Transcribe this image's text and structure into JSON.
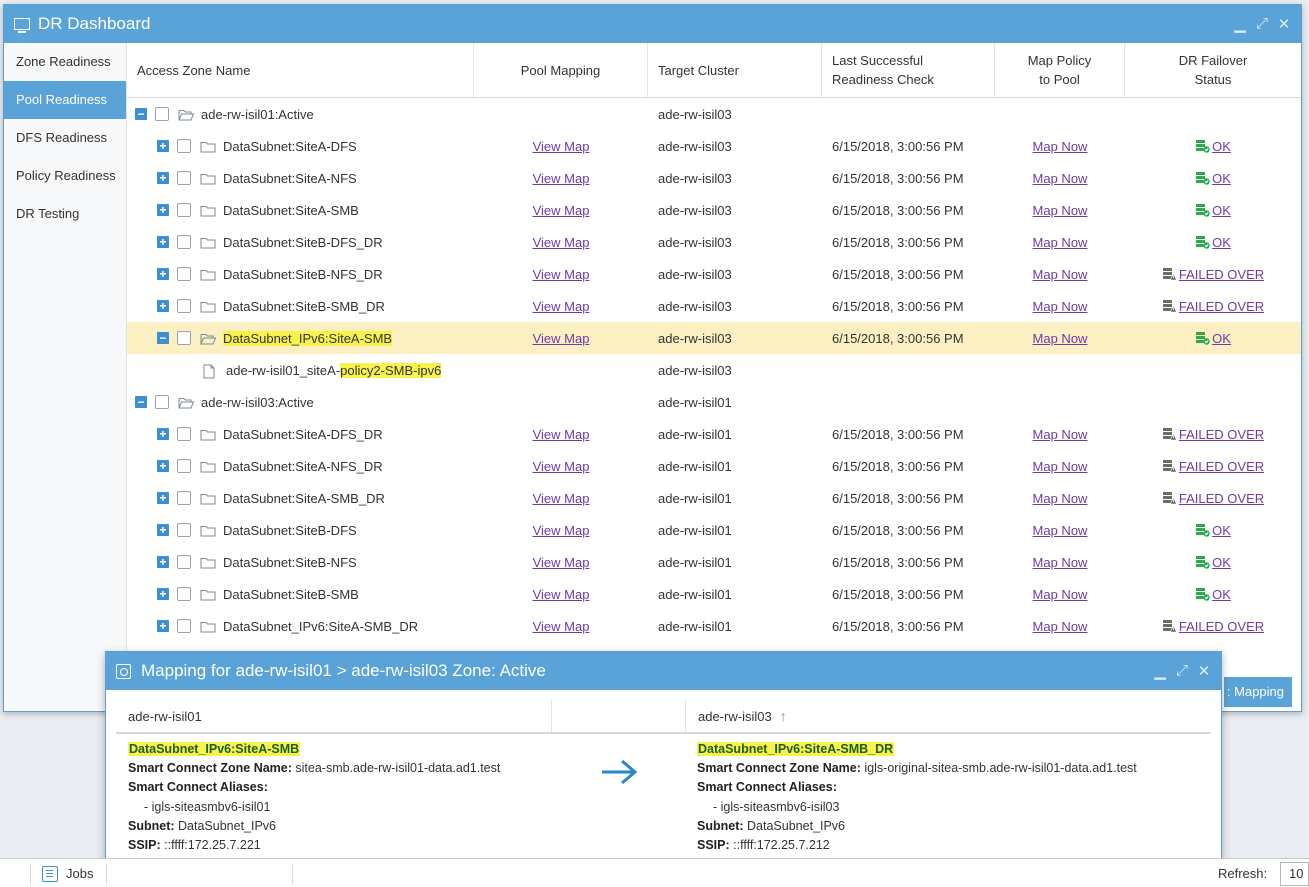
{
  "window": {
    "title": "DR Dashboard",
    "controls": {
      "minimize": "▁",
      "maximize": "⤢",
      "close": "✕"
    }
  },
  "sidebar": {
    "items": [
      {
        "label": "Zone Readiness",
        "active": false
      },
      {
        "label": "Pool Readiness",
        "active": true
      },
      {
        "label": "DFS Readiness",
        "active": false
      },
      {
        "label": "Policy Readiness",
        "active": false
      },
      {
        "label": "DR Testing",
        "active": false
      }
    ]
  },
  "grid": {
    "headers": {
      "access_zone": "Access Zone Name",
      "pool_mapping": "Pool Mapping",
      "target_cluster": "Target Cluster",
      "last_check_1": "Last Successful",
      "last_check_2": "Readiness Check",
      "map_policy_1": "Map Policy",
      "map_policy_2": "to Pool",
      "dr_status_1": "DR Failover",
      "dr_status_2": "Status"
    },
    "rows": [
      {
        "type": "zone",
        "name": "ade-rw-isil01:Active",
        "target": "ade-rw-isil03"
      },
      {
        "type": "pool",
        "name": "DataSubnet:SiteA-DFS",
        "map": "View Map",
        "target": "ade-rw-isil03",
        "check": "6/15/2018, 3:00:56 PM",
        "policy": "Map Now",
        "status": "OK"
      },
      {
        "type": "pool",
        "name": "DataSubnet:SiteA-NFS",
        "map": "View Map",
        "target": "ade-rw-isil03",
        "check": "6/15/2018, 3:00:56 PM",
        "policy": "Map Now",
        "status": "OK"
      },
      {
        "type": "pool",
        "name": "DataSubnet:SiteA-SMB",
        "map": "View Map",
        "target": "ade-rw-isil03",
        "check": "6/15/2018, 3:00:56 PM",
        "policy": "Map Now",
        "status": "OK"
      },
      {
        "type": "pool",
        "name": "DataSubnet:SiteB-DFS_DR",
        "map": "View Map",
        "target": "ade-rw-isil03",
        "check": "6/15/2018, 3:00:56 PM",
        "policy": "Map Now",
        "status": "OK"
      },
      {
        "type": "pool",
        "name": "DataSubnet:SiteB-NFS_DR",
        "map": "View Map",
        "target": "ade-rw-isil03",
        "check": "6/15/2018, 3:00:56 PM",
        "policy": "Map Now",
        "status": "FAILED OVER"
      },
      {
        "type": "pool",
        "name": "DataSubnet:SiteB-SMB_DR",
        "map": "View Map",
        "target": "ade-rw-isil03",
        "check": "6/15/2018, 3:00:56 PM",
        "policy": "Map Now",
        "status": "FAILED OVER"
      },
      {
        "type": "pool-open",
        "name": "DataSubnet_IPv6:SiteA-SMB",
        "map": "View Map",
        "target": "ade-rw-isil03",
        "check": "6/15/2018, 3:00:56 PM",
        "policy": "Map Now",
        "status": "OK",
        "selected": true,
        "highlight": true
      },
      {
        "type": "policy",
        "name_prefix": "ade-rw-isil01_siteA-",
        "name_highlight": "policy2-SMB-ipv6",
        "target": "ade-rw-isil03"
      },
      {
        "type": "zone",
        "name": "ade-rw-isil03:Active",
        "target": "ade-rw-isil01"
      },
      {
        "type": "pool",
        "name": "DataSubnet:SiteA-DFS_DR",
        "map": "View Map",
        "target": "ade-rw-isil01",
        "check": "6/15/2018, 3:00:56 PM",
        "policy": "Map Now",
        "status": "FAILED OVER"
      },
      {
        "type": "pool",
        "name": "DataSubnet:SiteA-NFS_DR",
        "map": "View Map",
        "target": "ade-rw-isil01",
        "check": "6/15/2018, 3:00:56 PM",
        "policy": "Map Now",
        "status": "FAILED OVER"
      },
      {
        "type": "pool",
        "name": "DataSubnet:SiteA-SMB_DR",
        "map": "View Map",
        "target": "ade-rw-isil01",
        "check": "6/15/2018, 3:00:56 PM",
        "policy": "Map Now",
        "status": "FAILED OVER"
      },
      {
        "type": "pool",
        "name": "DataSubnet:SiteB-DFS",
        "map": "View Map",
        "target": "ade-rw-isil01",
        "check": "6/15/2018, 3:00:56 PM",
        "policy": "Map Now",
        "status": "OK"
      },
      {
        "type": "pool",
        "name": "DataSubnet:SiteB-NFS",
        "map": "View Map",
        "target": "ade-rw-isil01",
        "check": "6/15/2018, 3:00:56 PM",
        "policy": "Map Now",
        "status": "OK"
      },
      {
        "type": "pool",
        "name": "DataSubnet:SiteB-SMB",
        "map": "View Map",
        "target": "ade-rw-isil01",
        "check": "6/15/2018, 3:00:56 PM",
        "policy": "Map Now",
        "status": "OK"
      },
      {
        "type": "pool",
        "name": "DataSubnet_IPv6:SiteA-SMB_DR",
        "map": "View Map",
        "target": "ade-rw-isil01",
        "check": "6/15/2018, 3:00:56 PM",
        "policy": "Map Now",
        "status": "FAILED OVER"
      }
    ]
  },
  "edge_button": ": Mapping",
  "mapping_popup": {
    "title": "Mapping for ade-rw-isil01 > ade-rw-isil03 Zone: Active",
    "left_header": "ade-rw-isil01",
    "right_header": "ade-rw-isil03",
    "sort_icon": "↑",
    "left": {
      "pool": "DataSubnet_IPv6:SiteA-SMB",
      "sc_zone_label": "Smart Connect Zone Name:",
      "sc_zone": "sitea-smb.ade-rw-isil01-data.ad1.test",
      "aliases_label": "Smart Connect Aliases:",
      "alias": "- igls-siteasmbv6-isil01",
      "subnet_label": "Subnet:",
      "subnet": "DataSubnet_IPv6",
      "ssip_label": "SSIP:",
      "ssip": "::ffff:172.25.7.221"
    },
    "right": {
      "pool": "DataSubnet_IPv6:SiteA-SMB_DR",
      "sc_zone_label": "Smart Connect Zone Name:",
      "sc_zone": "igls-original-sitea-smb.ade-rw-isil01-data.ad1.test",
      "aliases_label": "Smart Connect Aliases:",
      "alias": "- igls-siteasmbv6-isil03",
      "subnet_label": "Subnet:",
      "subnet": "DataSubnet_IPv6",
      "ssip_label": "SSIP:",
      "ssip": "::ffff:172.25.7.212"
    }
  },
  "statusbar": {
    "jobs_label": "Jobs",
    "refresh_label": "Refresh:",
    "refresh_value": "10"
  },
  "colors": {
    "accent": "#5aa3d8",
    "selected_row": "#fcefc1",
    "highlight": "#f7f34a",
    "link": "#6f3aa8",
    "ok_icon": "#2eaa4a",
    "failed_icon": "#6b6b6b"
  }
}
